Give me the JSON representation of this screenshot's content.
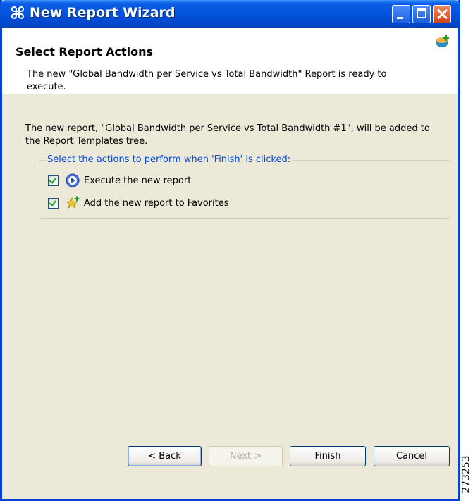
{
  "window": {
    "title": "New Report Wizard",
    "app_icon": "cisco-app-icon"
  },
  "header": {
    "title": "Select Report Actions",
    "description": "The new \"Global Bandwidth per Service vs Total Bandwidth\" Report is ready to execute."
  },
  "body": {
    "intro": "The new report, \"Global Bandwidth per Service vs Total Bandwidth #1\", will be added to the Report Templates tree.",
    "group_label": "Select the actions to perform when 'Finish' is clicked:",
    "options": [
      {
        "label": "Execute the new report",
        "checked": true,
        "icon": "execute-icon"
      },
      {
        "label": "Add the new report to Favorites",
        "checked": true,
        "icon": "favorites-star-icon"
      }
    ]
  },
  "buttons": {
    "back": "< Back",
    "next": "Next >",
    "finish": "Finish",
    "cancel": "Cancel"
  },
  "figure_id": "273253",
  "colors": {
    "titlebar": "#0553dc",
    "dialog_bg": "#ece9d8",
    "group_label": "#0046d5"
  }
}
